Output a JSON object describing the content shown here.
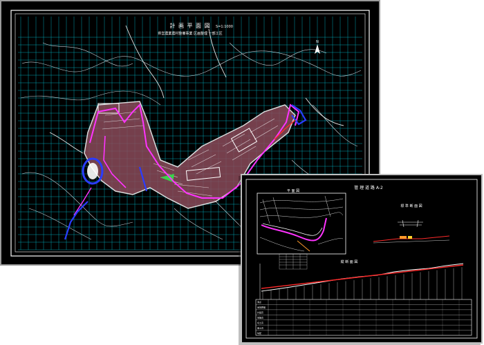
{
  "plan_sheet": {
    "title": "計 画 平 面 図",
    "scale": "S=1:1000",
    "subtitle": "県営農業農村整備事業  区画整理  一部工区",
    "north_mark": "N"
  },
  "detail_sheet": {
    "title": "管 理 道 路 A-2",
    "plan_inset_label": "平 面 図",
    "section_label": "標 準 断 面 図",
    "profile_label": "縦 断 面 図",
    "table_rows": [
      "測点",
      "追加距離",
      "計画高",
      "地盤高",
      "切土高",
      "盛土高",
      "勾配"
    ]
  },
  "colors": {
    "background": "#000000",
    "grid": "#00c8d8",
    "contour": "#ffffff",
    "boundary": "#ff33ff",
    "road": "#2a3cff",
    "profile_line": "#ff2a2a",
    "fill": "#b05a6a"
  }
}
